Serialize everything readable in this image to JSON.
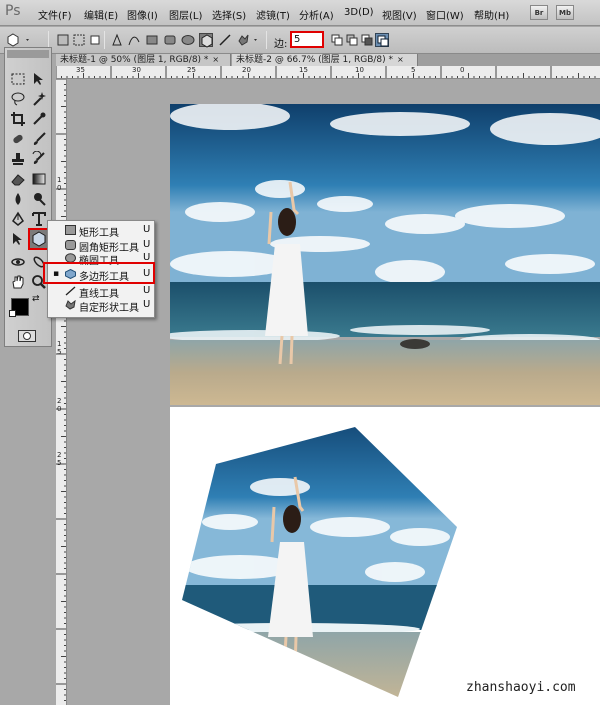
{
  "app": {
    "logo": "Ps"
  },
  "menu": [
    "文件(F)",
    "编辑(E)",
    "图像(I)",
    "图层(L)",
    "选择(S)",
    "滤镜(T)",
    "分析(A)",
    "3D(D)",
    "视图(V)",
    "窗口(W)",
    "帮助(H)"
  ],
  "app_buttons": [
    "Br",
    "Mb"
  ],
  "options": {
    "sides_label": "边:",
    "sides_value": "5"
  },
  "tabs": [
    {
      "label": "未标题-1 @ 50% (图层 1, RGB/8) *",
      "close": "×"
    },
    {
      "label": "未标题-2 @ 66.7% (图层 1, RGB/8) *",
      "close": "×"
    }
  ],
  "ruler": {
    "h_labels": [
      "35",
      "30",
      "25",
      "20",
      "15",
      "10",
      "5",
      "0"
    ],
    "v_labels": [
      "1",
      "0",
      "5",
      "1",
      "0",
      "1",
      "5",
      "2",
      "0",
      "2",
      "5"
    ]
  },
  "flyout": {
    "items": [
      {
        "bullet": "",
        "icon": "rectangle-icon",
        "label": "矩形工具",
        "key": "U"
      },
      {
        "bullet": "",
        "icon": "rounded-rectangle-icon",
        "label": "圆角矩形工具",
        "key": "U"
      },
      {
        "bullet": "",
        "icon": "ellipse-icon",
        "label": "椭圆工具",
        "key": "U"
      },
      {
        "bullet": "▪",
        "icon": "polygon-icon",
        "label": "多边形工具",
        "key": "U"
      },
      {
        "bullet": "",
        "icon": "line-icon",
        "label": "直线工具",
        "key": "U"
      },
      {
        "bullet": "",
        "icon": "custom-shape-icon",
        "label": "自定形状工具",
        "key": "U"
      }
    ]
  },
  "watermark": "zhanshaoyi.com",
  "colors": {
    "highlight": "#e00000",
    "sky": "#2a6f9e",
    "sea": "#1f5a7a",
    "sand": "#c7b69a"
  }
}
